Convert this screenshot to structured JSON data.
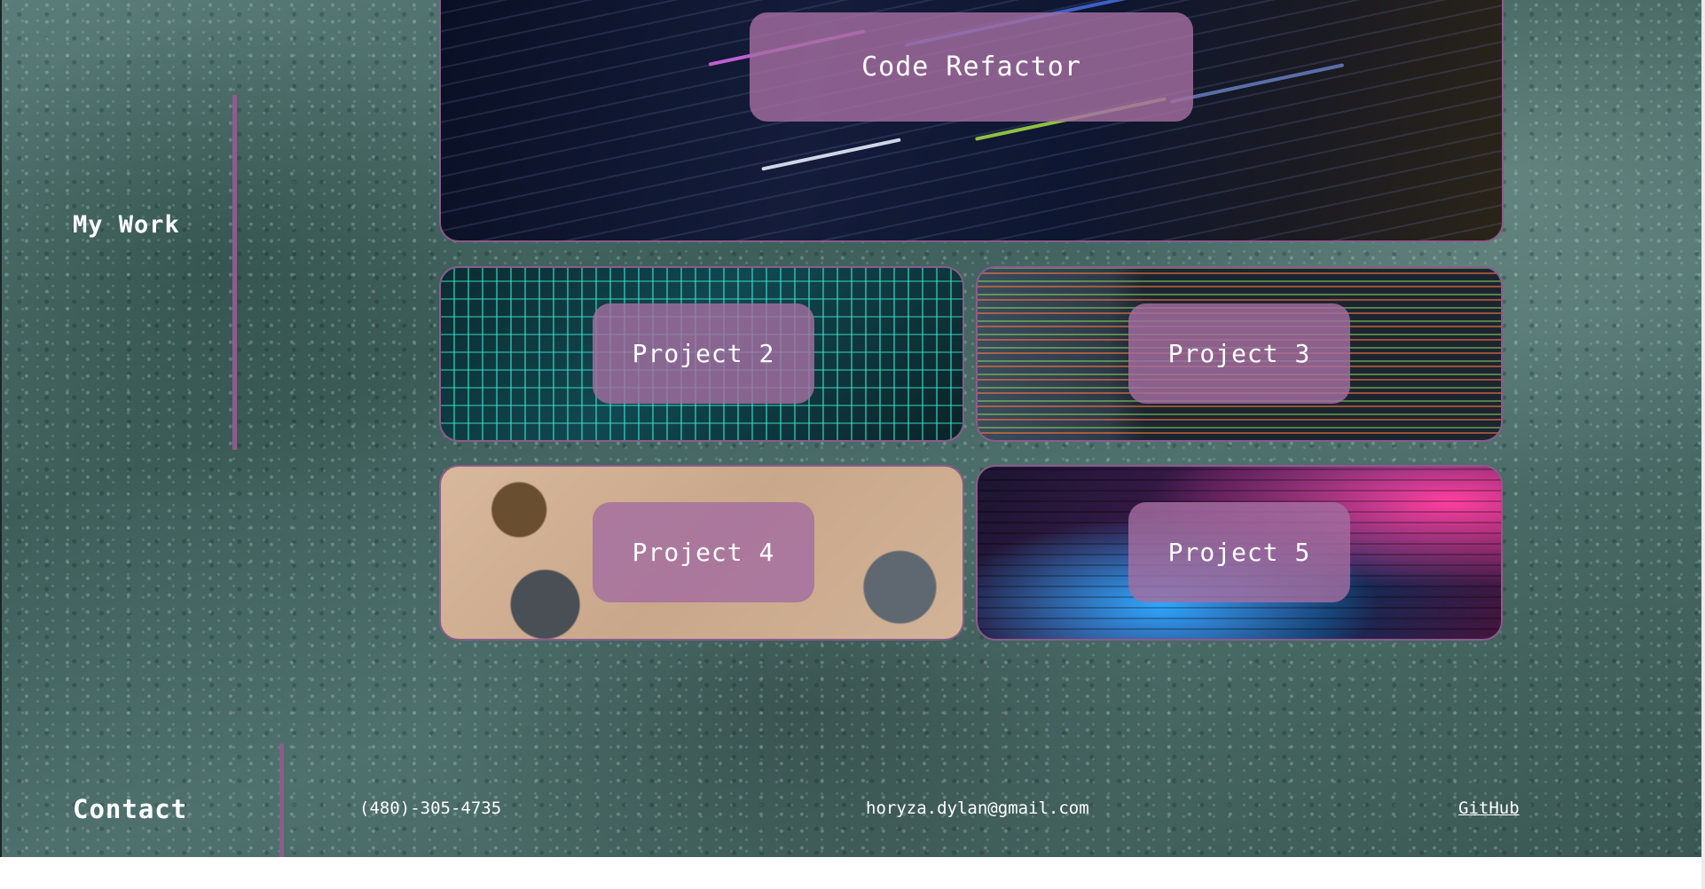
{
  "work": {
    "title": "My Work",
    "projects": [
      {
        "label": "Code Refactor"
      },
      {
        "label": "Project 2"
      },
      {
        "label": "Project 3"
      },
      {
        "label": "Project 4"
      },
      {
        "label": "Project 5"
      }
    ]
  },
  "contact": {
    "title": "Contact",
    "phone": "(480)-305-4735",
    "email": "horyza.dylan@gmail.com",
    "github": "GitHub"
  },
  "colors": {
    "accent": "#8e5c8c",
    "label_bg": "#a46ea0",
    "text": "#ffffff"
  }
}
